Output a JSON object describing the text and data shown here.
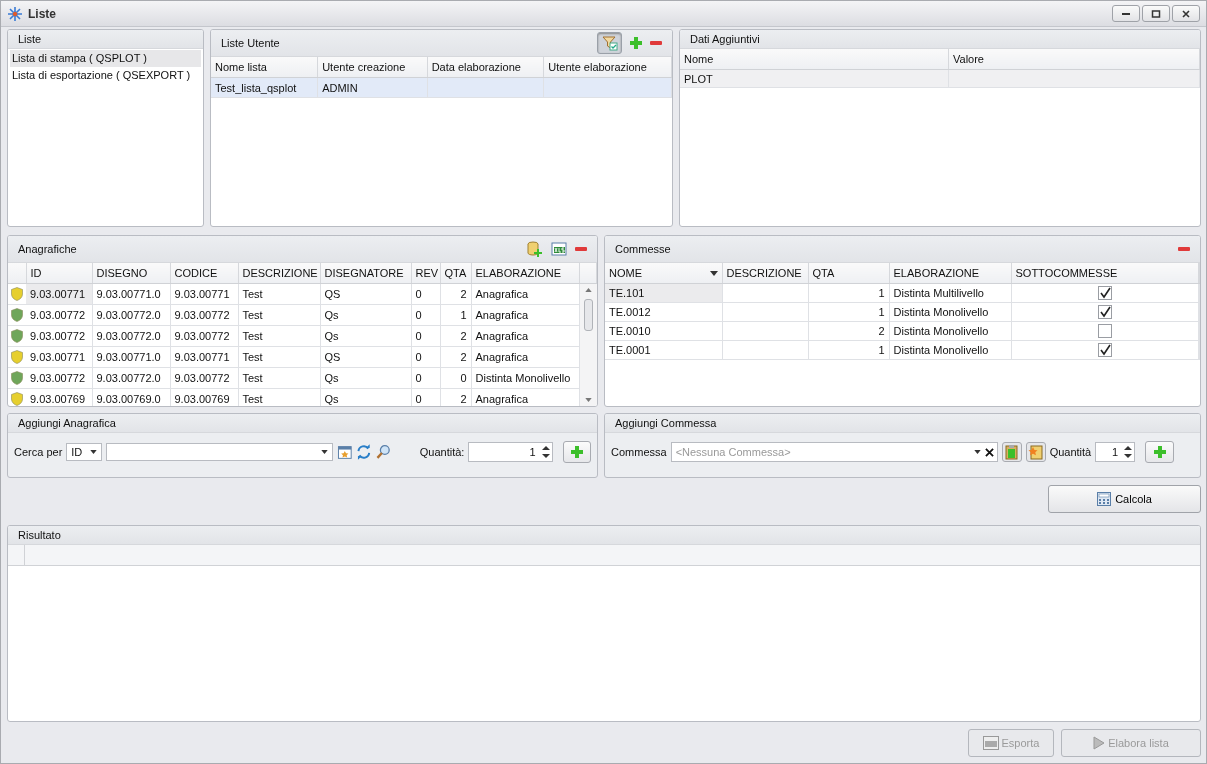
{
  "window": {
    "title": "Liste"
  },
  "liste": {
    "title": "Liste",
    "items": [
      {
        "label": "Lista di stampa ( QSPLOT )",
        "selected": true
      },
      {
        "label": "Lista di esportazione ( QSEXPORT )",
        "selected": false
      }
    ]
  },
  "liste_utente": {
    "title": "Liste Utente",
    "filter_active": true,
    "columns": [
      "Nome lista",
      "Utente creazione",
      "Data elaborazione",
      "Utente elaborazione"
    ],
    "rows": [
      {
        "cells": [
          "Test_lista_qsplot",
          "ADMIN"
        ],
        "selected": true
      }
    ]
  },
  "dati_aggiuntivi": {
    "title": "Dati Aggiuntivi",
    "columns": [
      "Nome",
      "Valore"
    ],
    "rows": [
      {
        "cells": [
          "PLOT"
        ]
      }
    ]
  },
  "anagrafiche": {
    "title": "Anagrafiche",
    "columns": [
      "ID",
      "DISEGNO",
      "CODICE",
      "DESCRIZIONE",
      "DISEGNATORE",
      "REV",
      "QTA",
      "ELABORAZIONE"
    ],
    "rows": [
      {
        "color": "#e6cf2e",
        "cells": [
          "9.03.00771",
          "9.03.00771.0",
          "9.03.00771",
          "Test",
          "QS",
          "0",
          "2",
          "Anagrafica"
        ]
      },
      {
        "color": "#6fa65a",
        "cells": [
          "9.03.00772",
          "9.03.00772.0",
          "9.03.00772",
          "Test",
          "Qs",
          "0",
          "1",
          "Anagrafica"
        ]
      },
      {
        "color": "#6fa65a",
        "cells": [
          "9.03.00772",
          "9.03.00772.0",
          "9.03.00772",
          "Test",
          "Qs",
          "0",
          "2",
          "Anagrafica"
        ]
      },
      {
        "color": "#e6cf2e",
        "cells": [
          "9.03.00771",
          "9.03.00771.0",
          "9.03.00771",
          "Test",
          "QS",
          "0",
          "2",
          "Anagrafica"
        ]
      },
      {
        "color": "#6fa65a",
        "cells": [
          "9.03.00772",
          "9.03.00772.0",
          "9.03.00772",
          "Test",
          "Qs",
          "0",
          "0",
          "Distinta Monolivello"
        ]
      },
      {
        "color": "#e6cf2e",
        "cells": [
          "9.03.00769",
          "9.03.00769.0",
          "9.03.00769",
          "Test",
          "Qs",
          "0",
          "2",
          "Anagrafica"
        ]
      }
    ]
  },
  "commesse": {
    "title": "Commesse",
    "columns": [
      {
        "label": "NOME",
        "sorted": true
      },
      {
        "label": "DESCRIZIONE",
        "sorted": false
      },
      {
        "label": "QTA",
        "sorted": false
      },
      {
        "label": "ELABORAZIONE",
        "sorted": false
      },
      {
        "label": "SOTTOCOMMESSE",
        "sorted": false
      }
    ],
    "rows": [
      {
        "nome": "TE.101",
        "qta": "1",
        "elaborazione": "Distinta Multilivello",
        "sottocommesse": true
      },
      {
        "nome": "TE.0012",
        "qta": "1",
        "elaborazione": "Distinta Monolivello",
        "sottocommesse": true
      },
      {
        "nome": "TE.0010",
        "qta": "2",
        "elaborazione": "Distinta Monolivello",
        "sottocommesse": false
      },
      {
        "nome": "TE.0001",
        "qta": "1",
        "elaborazione": "Distinta Monolivello",
        "sottocommesse": true
      }
    ]
  },
  "aggiungi_anagrafica": {
    "title": "Aggiungi Anagrafica",
    "search_label": "Cerca per",
    "search_by": "ID",
    "quantity_label": "Quantità:",
    "quantity": "1"
  },
  "aggiungi_commessa": {
    "title": "Aggiungi Commessa",
    "label": "Commessa",
    "placeholder": "<Nessuna Commessa>",
    "quantity_label": "Quantità",
    "quantity": "1"
  },
  "calcola": {
    "label": "Calcola"
  },
  "risultato": {
    "title": "Risultato"
  },
  "footer_buttons": [
    {
      "kind": "export",
      "label": "Esporta",
      "disabled": true
    },
    {
      "kind": "run",
      "label": "Elabora lista",
      "disabled": true
    }
  ]
}
